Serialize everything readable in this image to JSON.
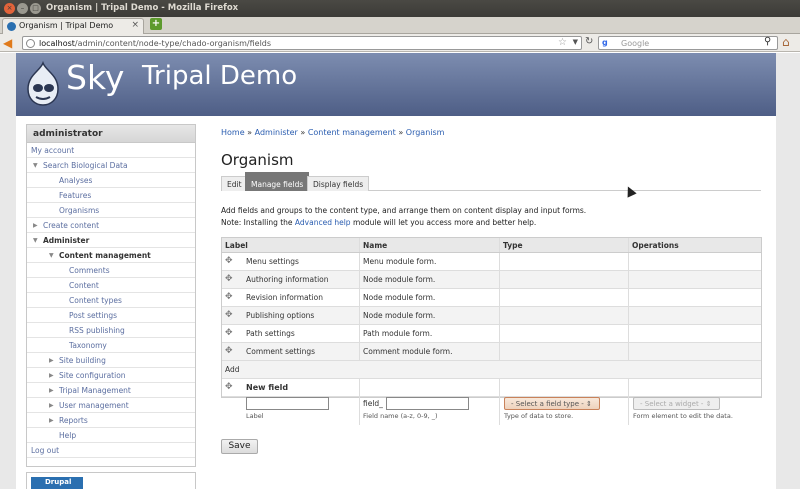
{
  "window": {
    "title": "Organism | Tripal Demo - Mozilla Firefox",
    "tab_label": "Organism | Tripal Demo",
    "tab_close": "×",
    "new_tab": "+"
  },
  "navbar": {
    "url_host": "localhost",
    "url_path": "/admin/content/node-type/chado-organism/fields",
    "search_engine": "g",
    "search_placeholder": "Google"
  },
  "site": {
    "logo_text": "Sky",
    "name": "Tripal Demo"
  },
  "sidebar": {
    "user": "administrator",
    "items": [
      {
        "label": "My account",
        "indent": 0,
        "arrow": "",
        "bold": false
      },
      {
        "label": "Search Biological Data",
        "indent": 1,
        "arrow": "▼",
        "bold": false
      },
      {
        "label": "Analyses",
        "indent": 2,
        "arrow": "",
        "bold": false
      },
      {
        "label": "Features",
        "indent": 2,
        "arrow": "",
        "bold": false
      },
      {
        "label": "Organisms",
        "indent": 2,
        "arrow": "",
        "bold": false
      },
      {
        "label": "Create content",
        "indent": 1,
        "arrow": "▶",
        "bold": false
      },
      {
        "label": "Administer",
        "indent": 1,
        "arrow": "▼",
        "bold": true
      },
      {
        "label": "Content management",
        "indent": 2,
        "arrow": "▼",
        "bold": true
      },
      {
        "label": "Comments",
        "indent": 3,
        "arrow": "",
        "bold": false
      },
      {
        "label": "Content",
        "indent": 3,
        "arrow": "",
        "bold": false
      },
      {
        "label": "Content types",
        "indent": 3,
        "arrow": "",
        "bold": false
      },
      {
        "label": "Post settings",
        "indent": 3,
        "arrow": "",
        "bold": false
      },
      {
        "label": "RSS publishing",
        "indent": 3,
        "arrow": "",
        "bold": false
      },
      {
        "label": "Taxonomy",
        "indent": 3,
        "arrow": "",
        "bold": false
      },
      {
        "label": "Site building",
        "indent": 2,
        "arrow": "▶",
        "bold": false
      },
      {
        "label": "Site configuration",
        "indent": 2,
        "arrow": "▶",
        "bold": false
      },
      {
        "label": "Tripal Management",
        "indent": 2,
        "arrow": "▶",
        "bold": false
      },
      {
        "label": "User management",
        "indent": 2,
        "arrow": "▶",
        "bold": false
      },
      {
        "label": "Reports",
        "indent": 2,
        "arrow": "▶",
        "bold": false
      },
      {
        "label": "Help",
        "indent": 2,
        "arrow": "",
        "bold": false
      },
      {
        "label": "Log out",
        "indent": 0,
        "arrow": "",
        "bold": false
      }
    ],
    "badge": "Drupal"
  },
  "breadcrumb": [
    "Home",
    "Administer",
    "Content management",
    "Organism"
  ],
  "breadcrumb_sep": " » ",
  "page_title": "Organism",
  "tabs": [
    {
      "label": "Edit",
      "active": false
    },
    {
      "label": "Manage fields",
      "active": true
    },
    {
      "label": "Display fields",
      "active": false
    }
  ],
  "help": {
    "line1": "Add fields and groups to the content type, and arrange them on content display and input forms.",
    "line2_before": "Note: Installing the ",
    "line2_link": "Advanced help",
    "line2_after": " module will let you access more and better help."
  },
  "table": {
    "headers": [
      "Label",
      "Name",
      "Type",
      "Operations"
    ],
    "rows": [
      {
        "label": "Menu settings",
        "name": "Menu module form."
      },
      {
        "label": "Authoring information",
        "name": "Node module form."
      },
      {
        "label": "Revision information",
        "name": "Node module form."
      },
      {
        "label": "Publishing options",
        "name": "Node module form."
      },
      {
        "label": "Path settings",
        "name": "Path module form."
      },
      {
        "label": "Comment settings",
        "name": "Comment module form."
      }
    ],
    "add_label": "Add",
    "new_field": {
      "title": "New field",
      "label_value": "",
      "label_desc": "Label",
      "name_prefix": "field_",
      "name_value": "",
      "name_desc": "Field name (a-z, 0-9, _)",
      "type_select": "- Select a field type -",
      "type_desc": "Type of data to store.",
      "widget_select": "- Select a widget -",
      "widget_desc": "Form element to edit the data."
    }
  },
  "save_label": "Save"
}
